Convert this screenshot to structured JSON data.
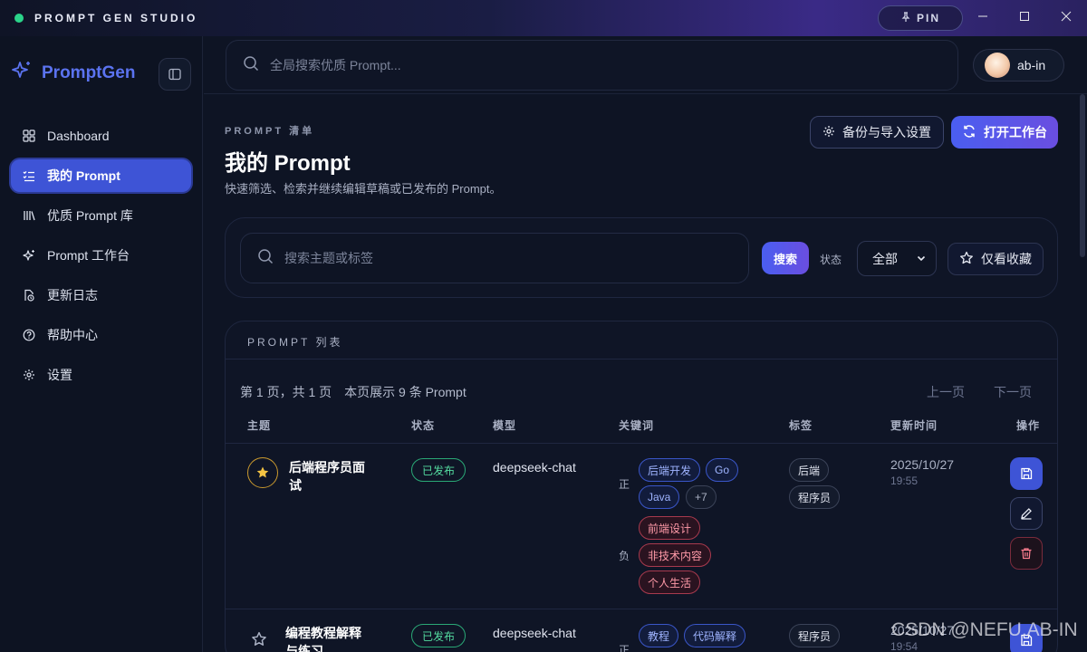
{
  "titlebar": {
    "title": "PROMPT GEN STUDIO",
    "pin_label": "PIN"
  },
  "sidebar": {
    "brand": "PromptGen",
    "items": [
      {
        "label": "Dashboard",
        "icon": "grid-icon",
        "active": false
      },
      {
        "label": "我的 Prompt",
        "icon": "checklist-icon",
        "active": true
      },
      {
        "label": "优质 Prompt 库",
        "icon": "library-icon",
        "active": false
      },
      {
        "label": "Prompt 工作台",
        "icon": "sparkles-icon",
        "active": false
      },
      {
        "label": "更新日志",
        "icon": "file-clock-icon",
        "active": false
      },
      {
        "label": "帮助中心",
        "icon": "help-circle-icon",
        "active": false
      },
      {
        "label": "设置",
        "icon": "gear-icon",
        "active": false
      }
    ]
  },
  "header": {
    "search_placeholder": "全局搜索优质 Prompt...",
    "username": "ab-in"
  },
  "page": {
    "eyebrow": "PROMPT 清单",
    "title": "我的 Prompt",
    "subtitle": "快速筛选、检索并继续编辑草稿或已发布的 Prompt。",
    "backup_button": "备份与导入设置",
    "open_workbench_button": "打开工作台"
  },
  "filter": {
    "search_placeholder": "搜索主题或标签",
    "search_button": "搜索",
    "status_label": "状态",
    "status_value": "全部",
    "favorites_button": "仅看收藏"
  },
  "list": {
    "eyebrow": "PROMPT 列表",
    "page_info": "第 1 页，共 1 页　本页展示 9 条 Prompt",
    "prev": "上一页",
    "next": "下一页",
    "columns": [
      "主题",
      "状态",
      "模型",
      "关键词",
      "标签",
      "更新时间",
      "操作"
    ],
    "rows": [
      {
        "favorite": true,
        "title": "后端程序员面试",
        "status": "已发布",
        "model": "deepseek-chat",
        "positive_sign": "正",
        "negative_sign": "负",
        "positive_keywords": [
          "后端开发",
          "Go",
          "Java"
        ],
        "more_count": "+7",
        "negative_keywords": [
          "前端设计",
          "非技术内容",
          "个人生活"
        ],
        "tags": [
          "后端",
          "程序员"
        ],
        "date": "2025/10/27",
        "time": "19:55"
      },
      {
        "favorite": false,
        "title": "编程教程解释与练习",
        "status": "已发布",
        "model": "deepseek-chat",
        "positive_sign": "正",
        "positive_keywords": [
          "教程",
          "代码解释"
        ],
        "tags": [
          "程序员"
        ],
        "date": "2025/10/27",
        "time": "19:54"
      }
    ]
  },
  "watermark": "CSDN @NEFU.AB-IN"
}
